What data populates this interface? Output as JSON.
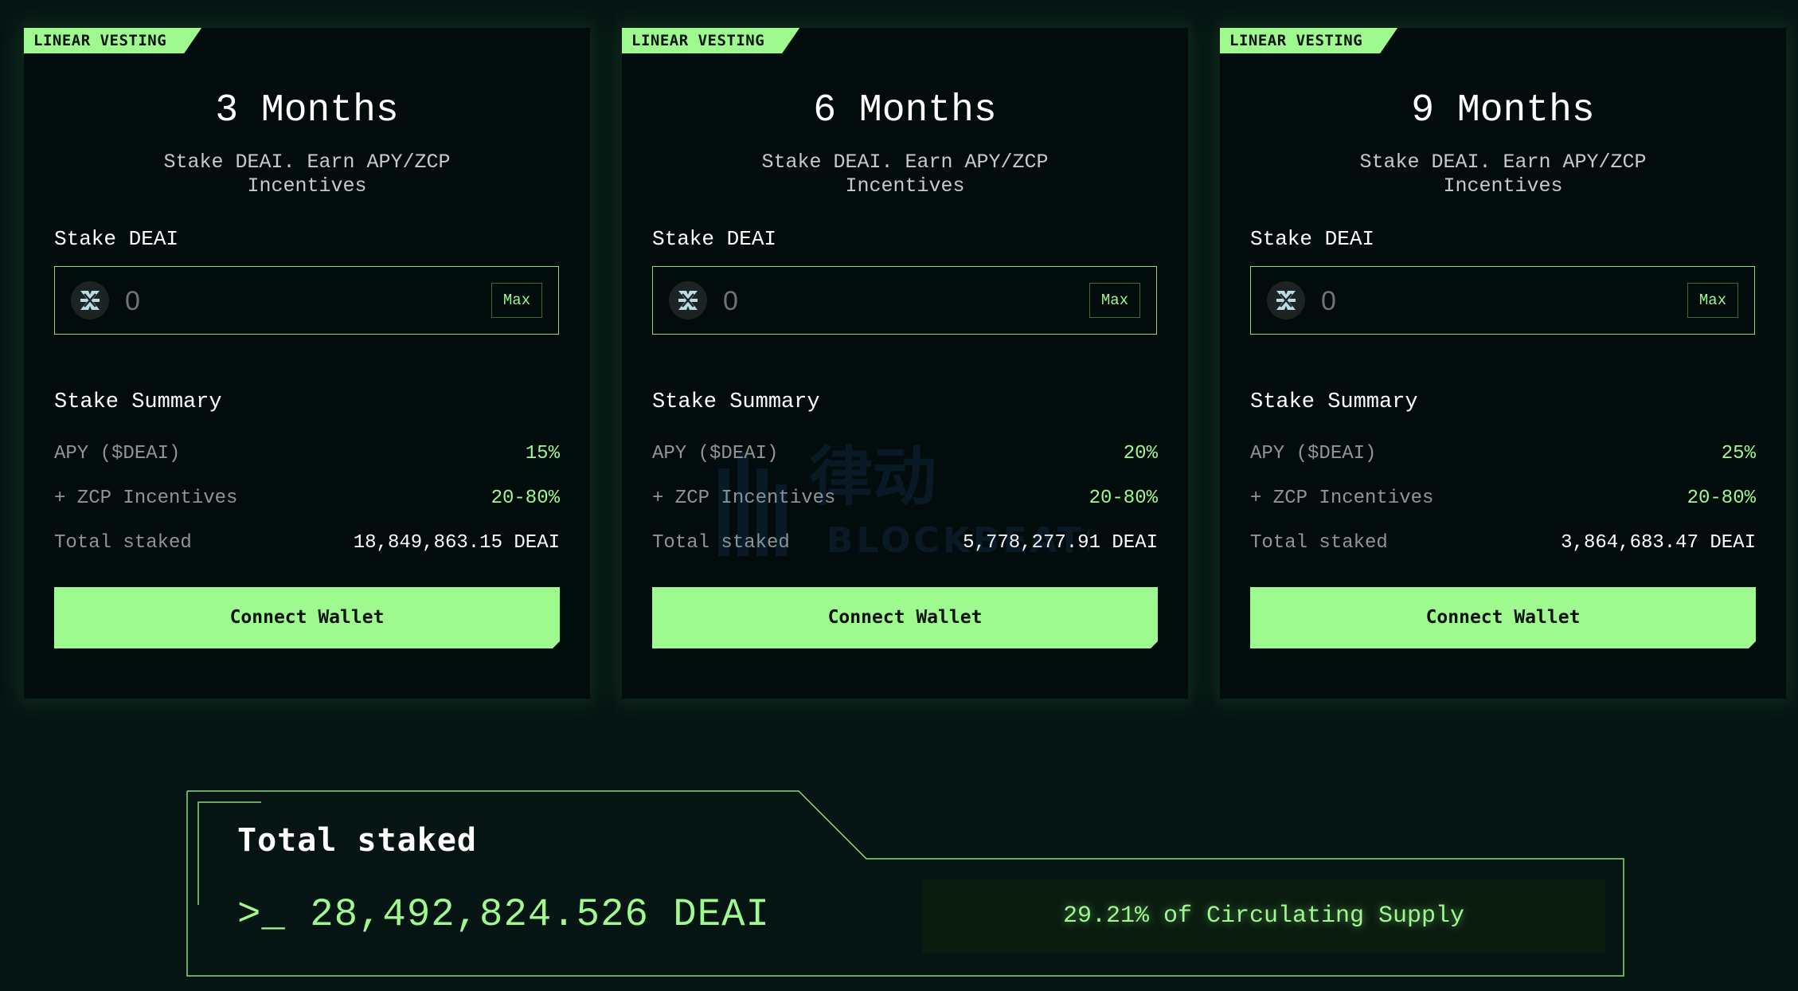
{
  "cards": [
    {
      "badge": "LINEAR VESTING",
      "title": "3 Months",
      "subtitle": "Stake DEAI. Earn APY/ZCP Incentives",
      "stake_label": "Stake DEAI",
      "amount": "0",
      "max_label": "Max",
      "summary_title": "Stake Summary",
      "apy_label": "APY ($DEAI)",
      "apy_value": "15%",
      "zcp_label": "+ ZCP Incentives",
      "zcp_value": "20-80%",
      "total_label": "Total staked",
      "total_value": "18,849,863.15 DEAI",
      "button_label": "Connect Wallet"
    },
    {
      "badge": "LINEAR VESTING",
      "title": "6 Months",
      "subtitle": "Stake DEAI. Earn APY/ZCP Incentives",
      "stake_label": "Stake DEAI",
      "amount": "0",
      "max_label": "Max",
      "summary_title": "Stake Summary",
      "apy_label": "APY ($DEAI)",
      "apy_value": "20%",
      "zcp_label": "+ ZCP Incentives",
      "zcp_value": "20-80%",
      "total_label": "Total staked",
      "total_value": "5,778,277.91 DEAI",
      "button_label": "Connect Wallet"
    },
    {
      "badge": "LINEAR VESTING",
      "title": "9 Months",
      "subtitle": "Stake DEAI. Earn APY/ZCP Incentives",
      "stake_label": "Stake DEAI",
      "amount": "0",
      "max_label": "Max",
      "summary_title": "Stake Summary",
      "apy_label": "APY ($DEAI)",
      "apy_value": "25%",
      "zcp_label": "+ ZCP Incentives",
      "zcp_value": "20-80%",
      "total_label": "Total staked",
      "total_value": "3,864,683.47 DEAI",
      "button_label": "Connect Wallet"
    }
  ],
  "token_icon": "deai-token-icon",
  "watermark": {
    "cn_text": "律动",
    "en_text": "BLOCKBEATS"
  },
  "total": {
    "title": "Total staked",
    "value": ">_ 28,492,824.526 DEAI",
    "supply": "29.21% of Circulating Supply"
  },
  "colors": {
    "accent": "#9ef98f",
    "background": "#061514",
    "card": "#030c0d",
    "muted_text": "#8e9695"
  }
}
